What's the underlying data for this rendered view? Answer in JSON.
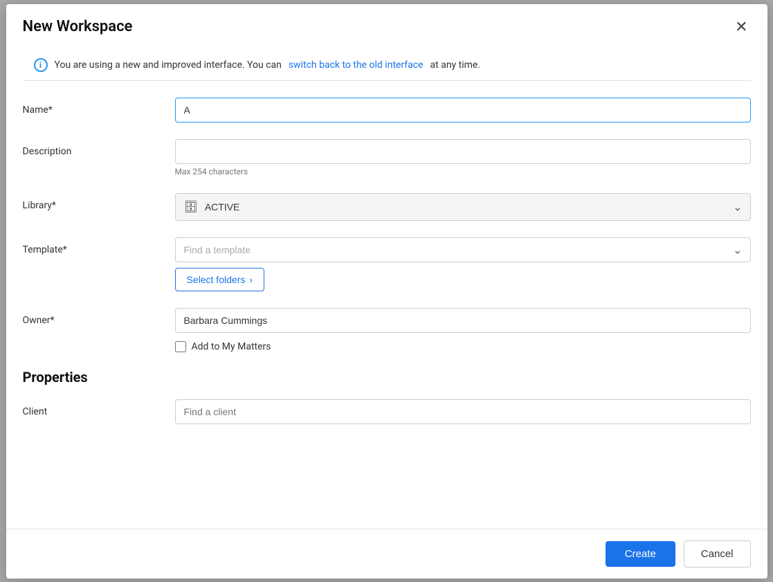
{
  "modal": {
    "title": "New Workspace",
    "close_label": "×"
  },
  "info_banner": {
    "text_before_link": "You are using a new and improved interface. You can ",
    "link_text": "switch back to the old interface",
    "text_after_link": " at any time.",
    "icon": "i"
  },
  "form": {
    "name_label": "Name*",
    "name_value": "A",
    "description_label": "Description",
    "description_placeholder": "",
    "description_char_limit": "Max 254 characters",
    "library_label": "Library*",
    "library_value": "ACTIVE",
    "template_label": "Template*",
    "template_placeholder": "Find a template",
    "select_folders_label": "Select folders",
    "select_folders_arrow": "›",
    "owner_label": "Owner*",
    "owner_value": "Barbara Cummings",
    "add_to_matters_label": "Add to My Matters"
  },
  "properties": {
    "section_title": "Properties",
    "client_label": "Client",
    "client_placeholder": "Find a client"
  },
  "footer": {
    "create_label": "Create",
    "cancel_label": "Cancel"
  }
}
